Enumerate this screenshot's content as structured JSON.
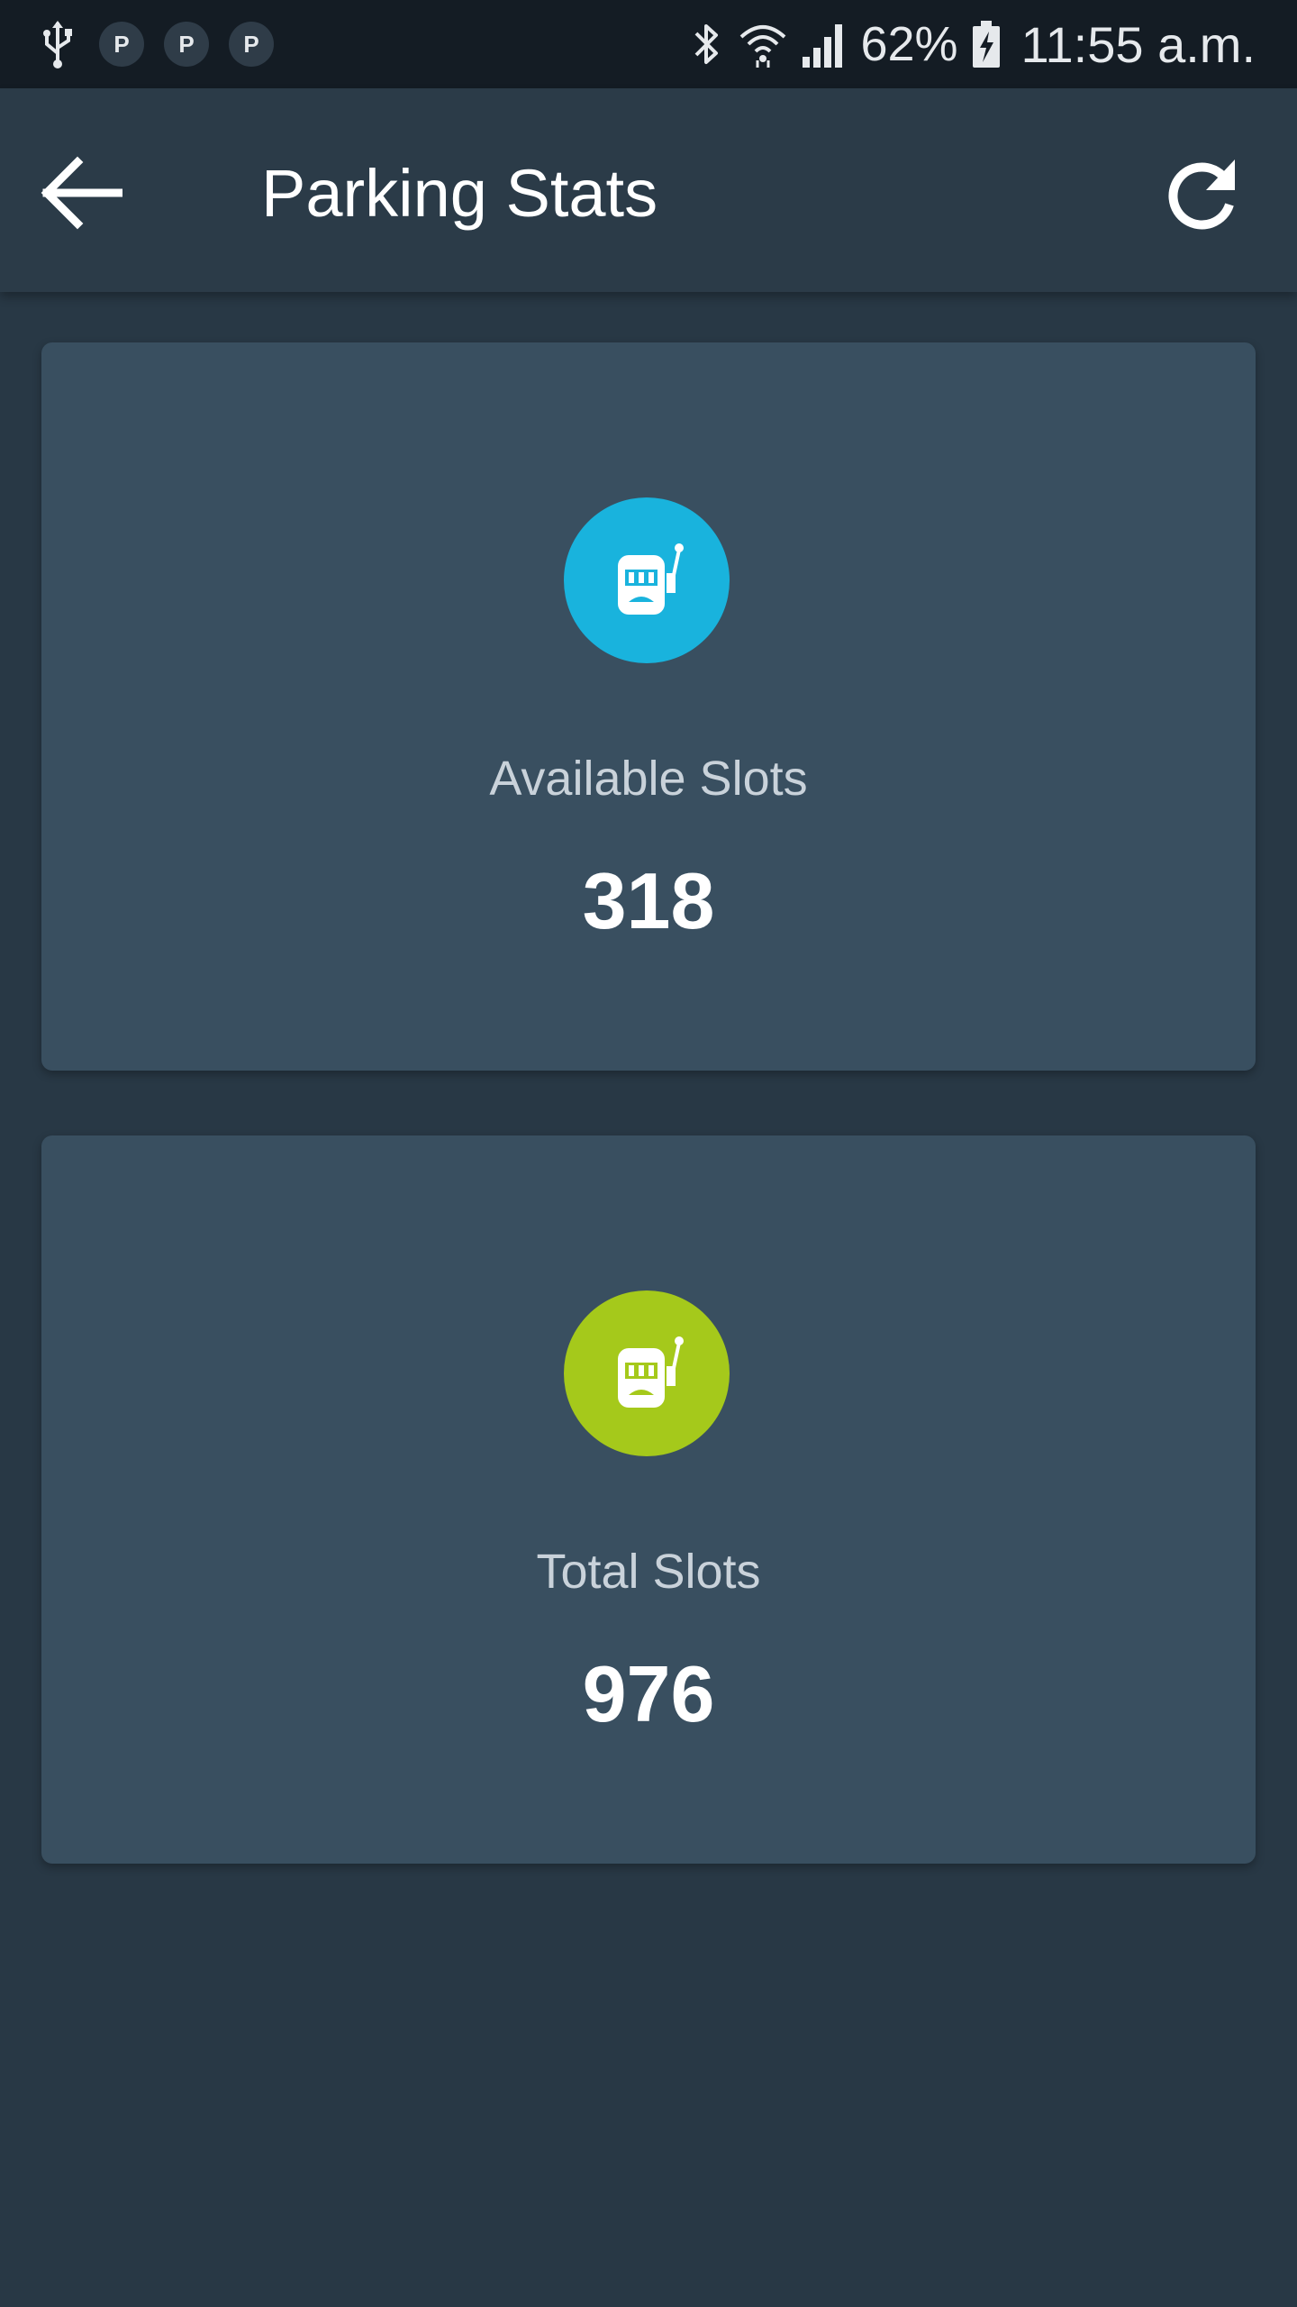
{
  "status_bar": {
    "notification_icons": [
      "usb-icon",
      "parking-icon",
      "parking-icon",
      "parking-icon"
    ],
    "notification_badges": [
      "P",
      "P",
      "P"
    ],
    "system_icons": [
      "bluetooth-icon",
      "wifi-icon",
      "signal-icon",
      "battery-charging-icon"
    ],
    "battery_percent": "62%",
    "time": "11:55 a.m."
  },
  "app_bar": {
    "title": "Parking Stats",
    "back_icon": "arrow-back-icon",
    "refresh_icon": "refresh-icon"
  },
  "cards": [
    {
      "label": "Available Slots",
      "value": "318",
      "icon": "slot-machine-icon",
      "icon_color": "#19b3dd"
    },
    {
      "label": "Total Slots",
      "value": "976",
      "icon": "slot-machine-icon",
      "icon_color": "#a5c91b"
    }
  ],
  "colors": {
    "background": "#283845",
    "status_bar": "#141c24",
    "app_bar": "#2b3b48",
    "card": "#394f60",
    "accent_blue": "#19b3dd",
    "accent_green": "#a5c91b"
  }
}
